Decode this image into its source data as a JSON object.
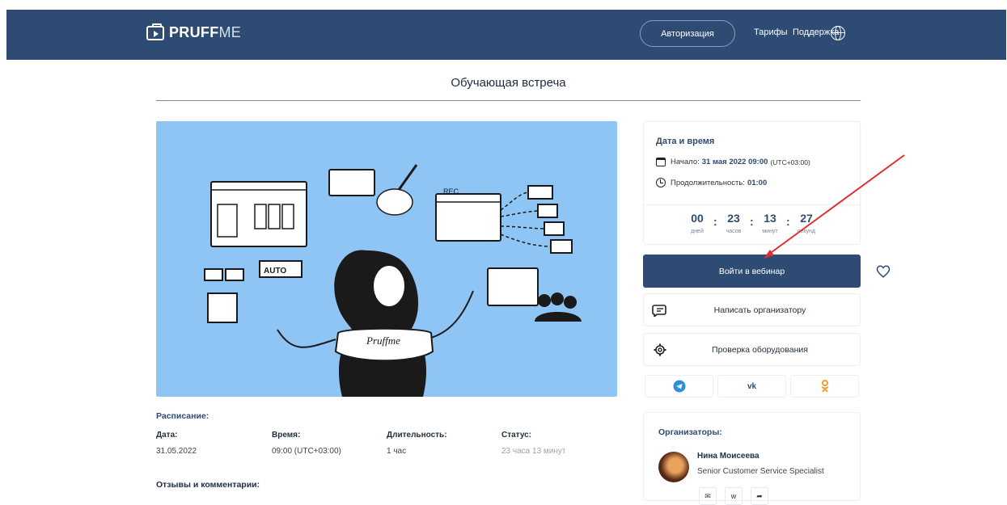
{
  "header": {
    "logo_bold": "PRUFF",
    "logo_light": "ME",
    "auth_label": "Авторизация",
    "tariffs_label": "Тарифы",
    "support_label": "Поддержка",
    "globe_icon": "globe-icon"
  },
  "page": {
    "title": "Обучающая встреча"
  },
  "datetime": {
    "heading": "Дата и время",
    "start_label": "Начало:",
    "start_value": "31 мая 2022 09:00",
    "start_tz": "(UTC+03:00)",
    "duration_label": "Продолжительность:",
    "duration_value": "01:00",
    "countdown": [
      {
        "value": "00",
        "unit": "дней"
      },
      {
        "value": "23",
        "unit": "часов"
      },
      {
        "value": "13",
        "unit": "минут"
      },
      {
        "value": "27",
        "unit": "секунд"
      }
    ]
  },
  "actions": {
    "enter_webinar": "Войти в вебинар",
    "message_organizer": "Написать организатору",
    "check_equipment": "Проверка оборудования"
  },
  "social": [
    "telegram-icon",
    "vk-icon",
    "odnoklassniki-icon"
  ],
  "social_text": {
    "vk": "vk",
    "ok": "ok"
  },
  "schedule": {
    "heading": "Расписание:",
    "columns": [
      {
        "header": "Дата:",
        "value": "31.05.2022"
      },
      {
        "header": "Время:",
        "value": "09:00 (UTC+03:00)"
      },
      {
        "header": "Длительность:",
        "value": "1 час"
      },
      {
        "header": "Статус:",
        "value": "23 часа 13 минут"
      }
    ]
  },
  "reviews": {
    "heading": "Отзывы и комментарии:"
  },
  "organizers": {
    "heading": "Организаторы:",
    "name": "Нина Моисеева",
    "role": "Senior Customer Service Specialist"
  },
  "hero": {
    "rec_text": "REC",
    "auto_text": "AUTO",
    "shirt_text": "Pruffme"
  },
  "colors": {
    "brand": "#2d4b73",
    "hero_bg": "#8fc5f4",
    "annotation_arrow": "#e52b2b"
  }
}
